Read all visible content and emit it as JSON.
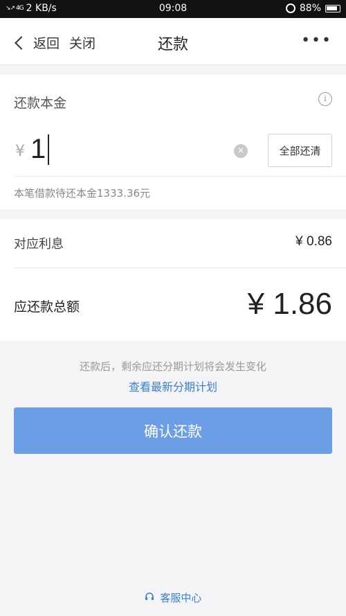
{
  "status_bar": {
    "signal": "↘↗ 4G",
    "speed": "2 KB/s",
    "time": "09:08",
    "battery": "88%"
  },
  "nav": {
    "back_label": "返回",
    "close_label": "关闭",
    "title": "还款",
    "more_label": "•••"
  },
  "principal": {
    "label": "还款本金",
    "info_icon": "i",
    "currency": "¥",
    "amount": "1",
    "repay_all_label": "全部还清",
    "remaining_text": "本笔借款待还本金1333.36元"
  },
  "summary": {
    "interest_label": "对应利息",
    "interest_value": "¥ 0.86",
    "total_label": "应还款总额",
    "total_value": "¥ 1.86"
  },
  "notice": {
    "text": "还款后，剩余应还分期计划将会发生变化",
    "link": "查看最新分期计划"
  },
  "confirm_label": "确认还款",
  "service_label": "客服中心",
  "colors": {
    "accent": "#6b9ee4",
    "link": "#3a7fd3",
    "background": "#f4f4f6"
  }
}
